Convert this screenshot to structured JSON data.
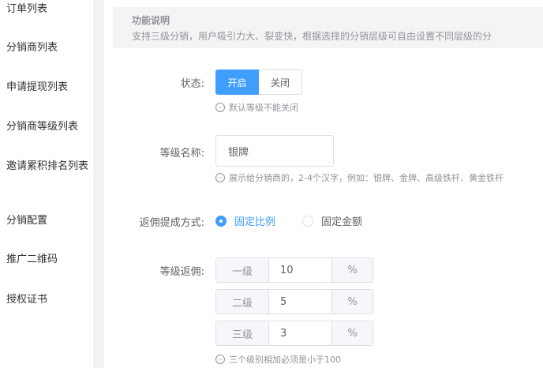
{
  "sidebar": {
    "items": [
      {
        "label": "订单列表"
      },
      {
        "label": "分销商列表"
      },
      {
        "label": "申请提现列表"
      },
      {
        "label": "分销商等级列表"
      },
      {
        "label": "邀请累积排名列表"
      },
      {
        "label": "分销配置"
      },
      {
        "label": "推广二维码"
      },
      {
        "label": "授权证书"
      }
    ]
  },
  "notice": {
    "title": "功能说明",
    "desc": "支持三级分销，用户吸引力大、裂变快，根据选择的分销层级可自由设置不同层级的分"
  },
  "form": {
    "status": {
      "label": "状态:",
      "on_label": "开启",
      "off_label": "关闭",
      "hint": "默认等级不能关闭"
    },
    "level_name": {
      "label": "等级名称:",
      "value": "银牌",
      "hint": "展示给分销商的，2-4个汉字，例如：银牌、金牌、高级铁杆、黄金铁杆"
    },
    "commission_mode": {
      "label": "返佣提成方式:",
      "options": [
        {
          "label": "固定比例",
          "checked": true
        },
        {
          "label": "固定金额",
          "checked": false
        }
      ]
    },
    "level_commission": {
      "label": "等级返佣:",
      "rows": [
        {
          "level": "一级",
          "value": "10",
          "unit": "%"
        },
        {
          "level": "二级",
          "value": "5",
          "unit": "%"
        },
        {
          "level": "三级",
          "value": "3",
          "unit": "%"
        }
      ],
      "hint": "三个级别相加必须是小于100"
    }
  },
  "colors": {
    "primary": "#409eff",
    "muted": "#909399",
    "border": "#dcdfe6"
  }
}
